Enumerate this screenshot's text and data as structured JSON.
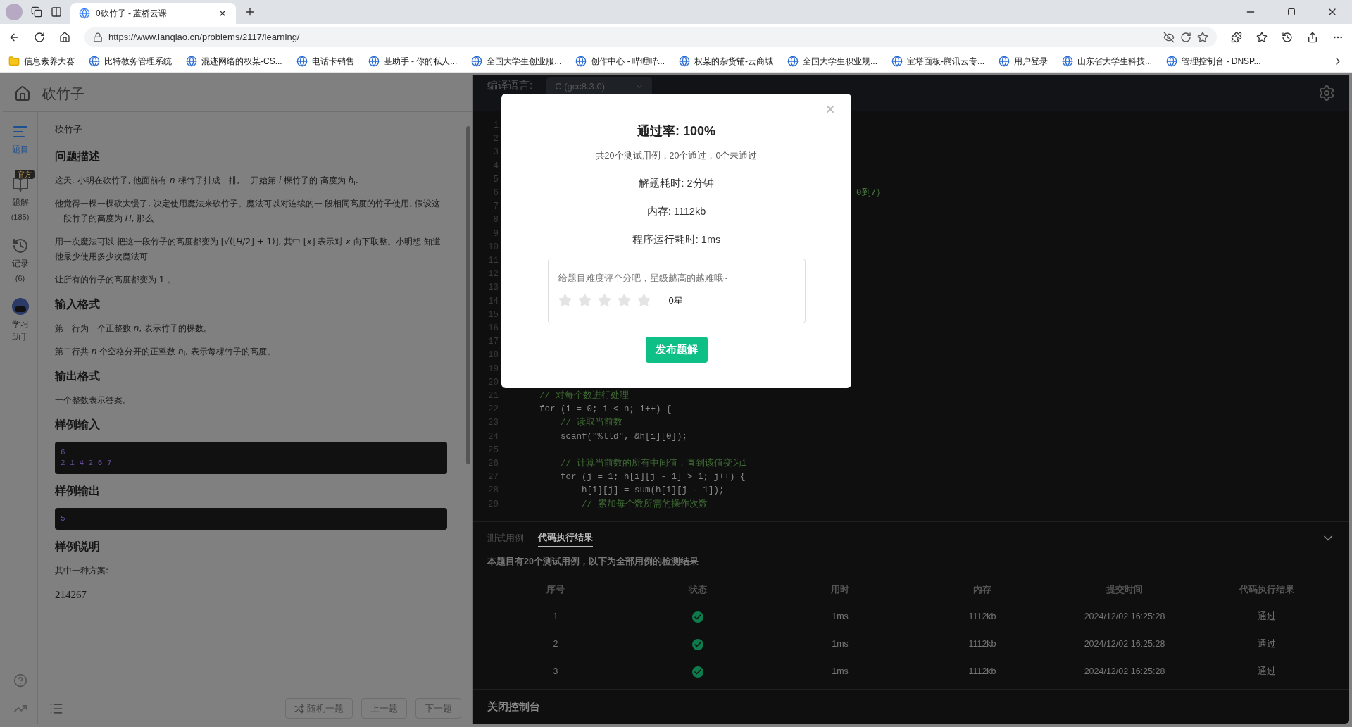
{
  "browser": {
    "tab_title": "0砍竹子 - 蓝桥云课",
    "url": "https://www.lanqiao.cn/problems/2117/learning/",
    "bookmarks": [
      {
        "label": "信息素养大赛",
        "kind": "folder"
      },
      {
        "label": "比特教务管理系统",
        "kind": "site"
      },
      {
        "label": "混迹网络的权某-CS...",
        "kind": "site"
      },
      {
        "label": "电话卡销售",
        "kind": "site"
      },
      {
        "label": "基助手 - 你的私人...",
        "kind": "site"
      },
      {
        "label": "全国大学生创业服...",
        "kind": "site"
      },
      {
        "label": "创作中心 - 哔哩哔...",
        "kind": "site"
      },
      {
        "label": "权某的杂货铺-云商城",
        "kind": "site"
      },
      {
        "label": "全国大学生职业规...",
        "kind": "site"
      },
      {
        "label": "宝塔面板-腾讯云专...",
        "kind": "site"
      },
      {
        "label": "用户登录",
        "kind": "site"
      },
      {
        "label": "山东省大学生科技...",
        "kind": "site"
      },
      {
        "label": "管理控制台 - DNSP...",
        "kind": "site"
      }
    ]
  },
  "problem": {
    "title": "砍竹子",
    "sidebar": [
      {
        "label": "题目",
        "selected": true,
        "kind": "list"
      },
      {
        "label": "题解",
        "count": "(185)",
        "badge": "官方",
        "selected": false,
        "kind": "book"
      },
      {
        "label": "记录",
        "count": "(6)",
        "selected": false,
        "kind": "history"
      },
      {
        "label": "学习助手",
        "selected": false,
        "kind": "bot"
      }
    ],
    "name": "砍竹子",
    "sections": [
      {
        "heading": "问题描述",
        "paragraphs": [
          "这天, 小明在砍竹子, 他面前有 *n* 棵竹子排成一排, 一开始第 *i* 棵竹子的 高度为 *h*$_{i}$.",
          "他觉得一棵一棵砍太慢了, 决定使用魔法来砍竹子。魔法可以对连续的一 段相同高度的竹子使用, 假设这一段竹子的高度为 *H*, 那么",
          "用一次魔法可以 把这一段竹子的高度都变为 ⌊√(⌊*H*/2⌋ + 1)⌋, 其中 ⌊*x*⌋ 表示对 *x* 向下取整。小明想 知道他最少使用多少次魔法可",
          "让所有的竹子的高度都变为 1 。"
        ]
      },
      {
        "heading": "输入格式",
        "paragraphs": [
          "第一行为一个正整数 *n*, 表示竹子的棵数。",
          "第二行共 *n* 个空格分开的正整数 *h*$_{i}$, 表示每棵竹子的高度。"
        ]
      },
      {
        "heading": "输出格式",
        "paragraphs": [
          "一个整数表示答案。"
        ]
      },
      {
        "heading": "样例输入",
        "code": [
          "6",
          "2 1 4 2 6 7"
        ]
      },
      {
        "heading": "样例输出",
        "code": [
          "5"
        ]
      },
      {
        "heading": "样例说明",
        "paragraphs": [
          "其中一种方案:"
        ]
      }
    ],
    "last_line": "214267",
    "buttons": [
      "随机一题",
      "上一题",
      "下一题"
    ]
  },
  "editor": {
    "language_label": "编译语言:",
    "language": "C (gcc8.3.0)",
    "lines": [
      {
        "n": "1"
      },
      {
        "n": "2"
      },
      {
        "n": "3"
      },
      {
        "n": "4"
      },
      {
        "n": "5"
      },
      {
        "n": "6",
        "code": "0到7）",
        "kind": "fragment"
      },
      {
        "n": "7"
      },
      {
        "n": "8"
      },
      {
        "n": "9"
      },
      {
        "n": "10"
      },
      {
        "n": "11"
      },
      {
        "n": "12"
      },
      {
        "n": "13"
      },
      {
        "n": "14"
      },
      {
        "n": "15"
      },
      {
        "n": "16"
      },
      {
        "n": "17"
      },
      {
        "n": "18"
      },
      {
        "n": "19"
      },
      {
        "n": "20"
      },
      {
        "n": "21",
        "code": "    // 对每个数进行处理",
        "kind": "comment"
      },
      {
        "n": "22",
        "code": "    for (i = 0; i < n; i++) {",
        "kind": "code"
      },
      {
        "n": "23",
        "code": "        // 读取当前数",
        "kind": "comment"
      },
      {
        "n": "24",
        "code": "        scanf(\"%lld\", &h[i][0]);",
        "kind": "code"
      },
      {
        "n": "25"
      },
      {
        "n": "26",
        "code": "        // 计算当前数的所有中间值，直到该值变为1",
        "kind": "comment"
      },
      {
        "n": "27",
        "code": "        for (j = 1; h[i][j - 1] > 1; j++) {",
        "kind": "code"
      },
      {
        "n": "28",
        "code": "            h[i][j] = sum(h[i][j - 1]);",
        "kind": "code"
      },
      {
        "n": "29",
        "code": "            // 累加每个数所需的操作次数",
        "kind": "comment"
      }
    ]
  },
  "console": {
    "tabs": [
      {
        "label": "测试用例",
        "selected": false
      },
      {
        "label": "代码执行结果",
        "selected": true
      }
    ],
    "summary": "本题目有20个测试用例，以下为全部用例的检测结果",
    "columns": [
      "序号",
      "状态",
      "用时",
      "内存",
      "提交时间",
      "代码执行结果"
    ],
    "rows": [
      {
        "index": "1",
        "passed": true,
        "time": "1ms",
        "memory": "1112kb",
        "submitted": "2024/12/02 16:25:28",
        "result": "通过"
      },
      {
        "index": "2",
        "passed": true,
        "time": "1ms",
        "memory": "1112kb",
        "submitted": "2024/12/02 16:25:28",
        "result": "通过"
      },
      {
        "index": "3",
        "passed": true,
        "time": "1ms",
        "memory": "1112kb",
        "submitted": "2024/12/02 16:25:28",
        "result": "通过"
      }
    ],
    "close_label": "关闭控制台"
  },
  "modal": {
    "title": "通过率: 100%",
    "subtitle": "共20个测试用例，20个通过，0个未通过",
    "stats": [
      "解题耗时: 2分钟",
      "内存: 1112kb",
      "程序运行耗时: 1ms"
    ],
    "rating_prompt": "给题目难度评个分吧，星级越高的越难哦~",
    "stars": 0,
    "stars_label": "0星",
    "button": "发布题解"
  }
}
